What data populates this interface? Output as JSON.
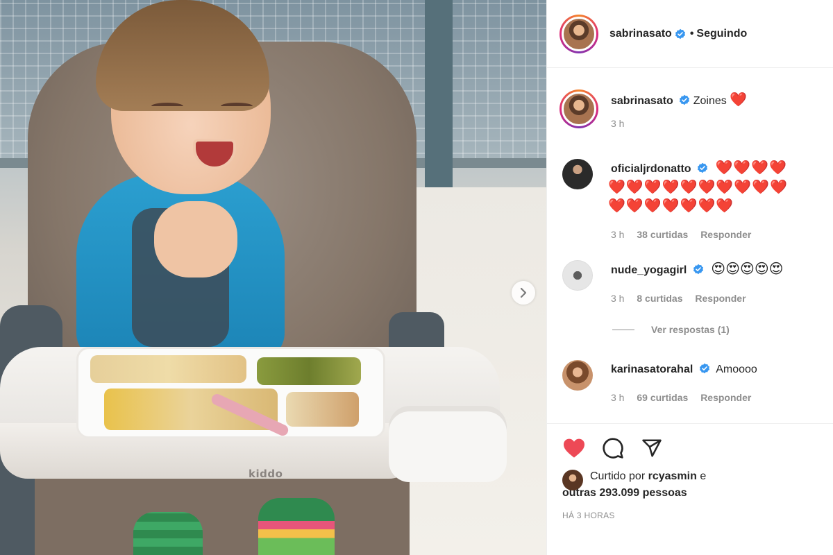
{
  "post": {
    "author": "sabrinasato",
    "follow_status": "Seguindo",
    "separator": "•",
    "photo_brand": "kiddo"
  },
  "caption": {
    "username": "sabrinasato",
    "text": "Zoines",
    "emoji": "❤️",
    "time": "3 h"
  },
  "comments": [
    {
      "username": "oficialjrdonatto",
      "hearts": [
        "❤️❤️❤️❤️",
        "❤️❤️❤️❤️❤️❤️❤️❤️❤️❤️",
        "❤️❤️❤️❤️❤️❤️❤️"
      ],
      "time": "3 h",
      "likes": "38 curtidas",
      "reply": "Responder"
    },
    {
      "username": "nude_yogagirl",
      "emoji": "😍😍😍😍😍",
      "time": "3 h",
      "likes": "8 curtidas",
      "reply": "Responder",
      "view_replies": "Ver respostas (1)"
    },
    {
      "username": "karinasatorahal",
      "text": "Amoooo",
      "time": "3 h",
      "likes": "69 curtidas",
      "reply": "Responder"
    }
  ],
  "likes": {
    "prefix": "Curtido por",
    "user": "rcyasmin",
    "conjunction": "e",
    "others": "outras 293.099 pessoas"
  },
  "timestamp": "HÁ 3 HORAS",
  "icons": {
    "verified": "verified-badge-icon",
    "like": "heart-icon",
    "comment": "comment-icon",
    "share": "share-icon",
    "next": "chevron-right-icon"
  },
  "colors": {
    "liked": "#ed4956",
    "verified": "#3897f0",
    "muted": "#8e8e8e"
  }
}
